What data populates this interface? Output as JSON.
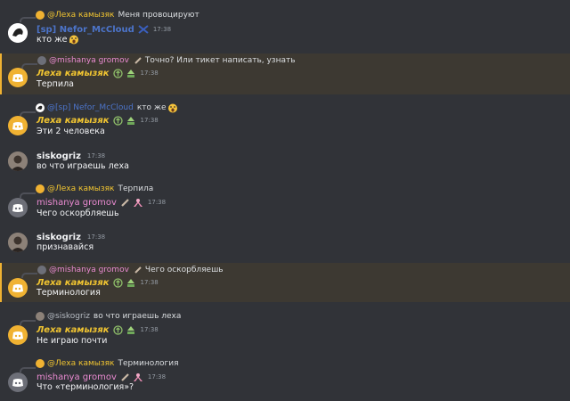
{
  "messages": [
    {
      "reply_name": "@Леха камызяк",
      "reply_text": "Меня провоцируют",
      "author": "[sp] Nefor_McCloud",
      "time": "17:38",
      "text": "кто же"
    },
    {
      "reply_name": "@mishanya gromov",
      "reply_text": "Точно? Или тикет написать, узнать",
      "author": "Леха камызяк",
      "time": "17:38",
      "text": "Терпила"
    },
    {
      "reply_name": "@[sp] Nefor_McCloud",
      "reply_text": "кто же",
      "author": "Леха камызяк",
      "time": "17:38",
      "text": "Эти 2 человека"
    },
    {
      "author": "siskogriz",
      "time": "17:38",
      "text": "во что играешь леха"
    },
    {
      "reply_name": "@Леха камызяк",
      "reply_text": "Терпила",
      "author": "mishanya gromov",
      "time": "17:38",
      "text": "Чего оскорбляешь"
    },
    {
      "author": "siskogriz",
      "time": "17:38",
      "text": "признавайся"
    },
    {
      "reply_name": "@mishanya gromov",
      "reply_text": "Чего оскорбляешь",
      "author": "Леха камызяк",
      "time": "17:38",
      "text": "Терминология"
    },
    {
      "reply_name": "@siskogriz",
      "reply_text": "во что играешь леха",
      "author": "Леха камызяк",
      "time": "17:38",
      "text": "Не играю почти"
    },
    {
      "reply_name": "@Леха камызяк",
      "reply_text": "Терминология",
      "author": "mishanya gromov",
      "time": "17:38",
      "text": "Что «терминология»?"
    }
  ],
  "colors": {
    "background": "#313338",
    "highlight": "#3d3932",
    "mention_bar": "#f0b232",
    "leha_name": "#f0c431",
    "mishanya_name": "#e98ad0",
    "nefor_name": "#4c74c9"
  }
}
